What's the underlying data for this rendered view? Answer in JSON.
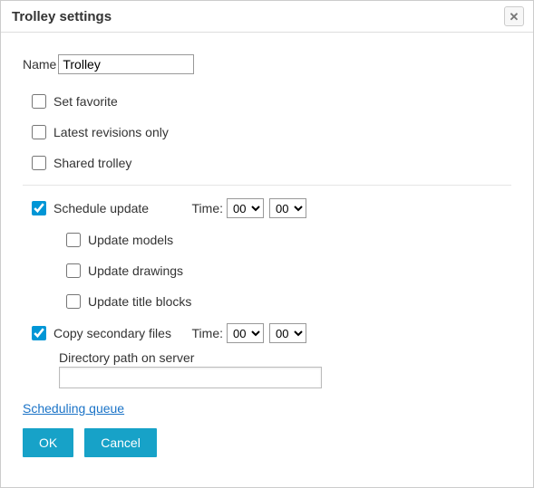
{
  "dialog": {
    "title": "Trolley settings"
  },
  "name": {
    "label": "Name",
    "value": "Trolley"
  },
  "options": {
    "set_favorite": "Set favorite",
    "latest_revisions": "Latest revisions only",
    "shared_trolley": "Shared trolley"
  },
  "schedule": {
    "label": "Schedule update",
    "checked": true,
    "time_label": "Time:",
    "hour": "00",
    "minute": "00",
    "sub": {
      "update_models": "Update models",
      "update_drawings": "Update drawings",
      "update_title_blocks": "Update title blocks"
    }
  },
  "copy": {
    "label": "Copy secondary files",
    "checked": true,
    "time_label": "Time:",
    "hour": "00",
    "minute": "00",
    "path_label": "Directory path on server",
    "path_value": ""
  },
  "link": {
    "scheduling_queue": "Scheduling queue"
  },
  "buttons": {
    "ok": "OK",
    "cancel": "Cancel"
  },
  "select_options": {
    "hours": [
      "00"
    ],
    "minutes": [
      "00"
    ]
  }
}
